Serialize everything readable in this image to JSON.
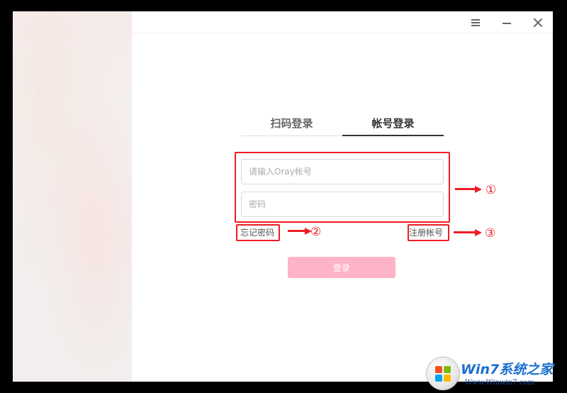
{
  "window": {
    "controls": {
      "menu_icon": "hamburger-icon",
      "minimize_icon": "minimize-icon",
      "close_icon": "close-icon"
    }
  },
  "tabs": [
    {
      "label": "扫码登录",
      "active": false
    },
    {
      "label": "帐号登录",
      "active": true
    }
  ],
  "form": {
    "account_placeholder": "请输入Oray帐号",
    "account_value": "",
    "password_placeholder": "密码",
    "password_value": "",
    "forgot_label": "忘记密码",
    "register_label": "注册帐号",
    "login_label": "登录"
  },
  "annotations": {
    "n1": "①",
    "n2": "②",
    "n3": "③",
    "color": "#ee1c24"
  },
  "watermark": {
    "title": "Win7系统之家",
    "url": "Www.Winwin7.com"
  },
  "colors": {
    "login_button": "#ffb3c6",
    "active_tab_underline": "#333333"
  }
}
